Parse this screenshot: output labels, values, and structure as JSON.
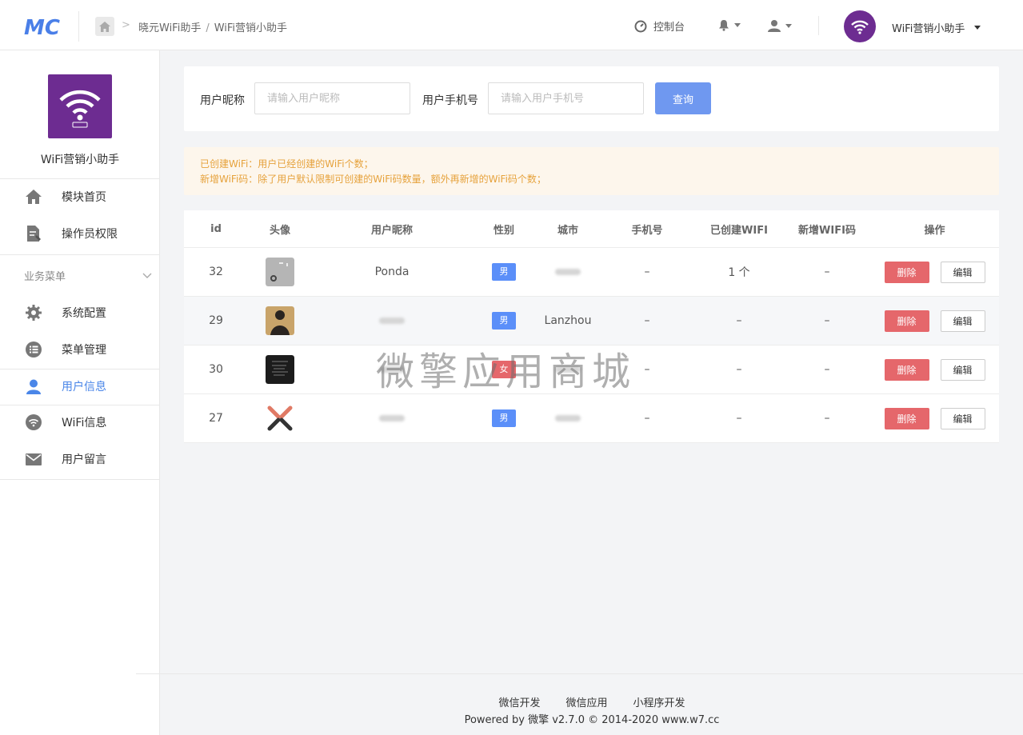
{
  "header": {
    "logo_text": "MC",
    "breadcrumb": [
      "晓元WiFi助手",
      "WiFi营销小助手"
    ],
    "console_label": "控制台",
    "account_name": "WiFi营销小助手"
  },
  "sidebar": {
    "app_name": "WiFi营销小助手",
    "top_items": [
      {
        "label": "模块首页",
        "icon": "home-icon"
      },
      {
        "label": "操作员权限",
        "icon": "edit-doc-icon"
      }
    ],
    "group_title": "业务菜单",
    "group_items": [
      {
        "label": "系统配置",
        "icon": "gear-icon"
      },
      {
        "label": "菜单管理",
        "icon": "list-icon"
      },
      {
        "label": "用户信息",
        "icon": "user-icon",
        "active": true
      },
      {
        "label": "WiFi信息",
        "icon": "wifi-icon"
      },
      {
        "label": "用户留言",
        "icon": "mail-icon"
      }
    ]
  },
  "search": {
    "nick_label": "用户昵称",
    "nick_placeholder": "请输入用户昵称",
    "phone_label": "用户手机号",
    "phone_placeholder": "请输入用户手机号",
    "submit_label": "查询"
  },
  "notice": {
    "line1": "已创建WiFi：用户已经创建的WiFi个数；",
    "line2": "新增WiFi码：除了用户默认限制可创建的WiFi码数量，额外再新增的WiFi码个数；"
  },
  "table": {
    "headers": [
      "id",
      "头像",
      "用户昵称",
      "性别",
      "城市",
      "手机号",
      "已创建WIFI",
      "新增WIFI码",
      "操作"
    ],
    "rows": [
      {
        "id": "32",
        "nickname": "Ponda",
        "sex": "男",
        "city": "",
        "phone": "–",
        "wifi_count": "1 个",
        "extra_codes": "–",
        "delete": "删除",
        "edit": "编辑"
      },
      {
        "id": "29",
        "nickname": "",
        "sex": "男",
        "city": "Lanzhou",
        "phone": "–",
        "wifi_count": "–",
        "extra_codes": "–",
        "delete": "删除",
        "edit": "编辑"
      },
      {
        "id": "30",
        "nickname": "",
        "sex": "女",
        "city": "",
        "phone": "–",
        "wifi_count": "–",
        "extra_codes": "–",
        "delete": "删除",
        "edit": "编辑"
      },
      {
        "id": "27",
        "nickname": "",
        "sex": "男",
        "city": "",
        "phone": "–",
        "wifi_count": "–",
        "extra_codes": "–",
        "delete": "删除",
        "edit": "编辑"
      }
    ]
  },
  "watermark": "微擎应用商城",
  "footer": {
    "links": [
      "微信开发",
      "微信应用",
      "小程序开发"
    ],
    "copyright": "Powered by 微擎 v2.7.0 © 2014-2020 www.w7.cc"
  },
  "colors": {
    "primary": "#6f98f0",
    "active_menu": "#4a86e8",
    "danger": "#e5676b",
    "brand_purple": "#6d2c91",
    "notice_text": "#e6a23c"
  }
}
